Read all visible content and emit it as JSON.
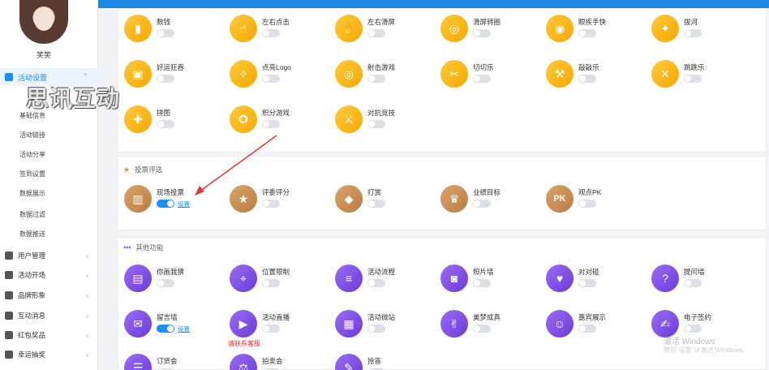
{
  "user": {
    "name": "笑笑"
  },
  "sidebar": {
    "active_menu": "活动设置",
    "submenu": [
      "活动设置",
      "基础信息",
      "活动链接",
      "活动分享",
      "签到设置",
      "数据展示",
      "数据过滤",
      "数据推送"
    ],
    "menus": [
      "用户管理",
      "活动开场",
      "品牌形象",
      "互动消息",
      "红包奖品",
      "幸运抽奖"
    ]
  },
  "watermark": "思讯互动",
  "sections": {
    "vote_title": "投票评选",
    "other_title": "其他功能"
  },
  "games": [
    {
      "label": "数钱",
      "icon": "money-icon"
    },
    {
      "label": "左右点击",
      "icon": "tap-icon"
    },
    {
      "label": "左右滑屏",
      "icon": "swipe-icon"
    },
    {
      "label": "滑屏转圈",
      "icon": "spin-icon"
    },
    {
      "label": "眼疾手快",
      "icon": "eye-icon"
    },
    {
      "label": "拔河",
      "icon": "tug-icon"
    },
    {
      "label": "好运狂吞",
      "icon": "bucket-icon"
    },
    {
      "label": "点亮Logo",
      "icon": "torch-icon"
    },
    {
      "label": "射击游戏",
      "icon": "target-icon"
    },
    {
      "label": "切切乐",
      "icon": "slice-icon"
    },
    {
      "label": "敲敲乐",
      "icon": "hammer-icon"
    },
    {
      "label": "跳跳乐",
      "icon": "jump-icon"
    },
    {
      "label": "拼图",
      "icon": "puzzle-icon"
    },
    {
      "label": "积分游戏",
      "icon": "score-icon"
    },
    {
      "label": "对抗竞技",
      "icon": "battle-icon"
    }
  ],
  "votes": [
    {
      "label": "现场投票",
      "icon": "bar-icon",
      "on": true,
      "link": "设置"
    },
    {
      "label": "评委评分",
      "icon": "judge-icon"
    },
    {
      "label": "打赏",
      "icon": "diamond-icon"
    },
    {
      "label": "业绩目标",
      "icon": "trophy-icon"
    },
    {
      "label": "观点PK",
      "icon": "pk-icon",
      "glyph": "PK"
    }
  ],
  "others": [
    {
      "label": "你画我猜",
      "icon": "clapper-icon"
    },
    {
      "label": "位置限制",
      "icon": "pin-icon"
    },
    {
      "label": "活动流程",
      "icon": "layers-icon"
    },
    {
      "label": "照片墙",
      "icon": "camera-icon"
    },
    {
      "label": "对对碰",
      "icon": "heart-icon"
    },
    {
      "label": "提问墙",
      "icon": "question-icon"
    },
    {
      "label": "留言墙",
      "icon": "message-icon",
      "on": true,
      "link": "设置"
    },
    {
      "label": "活动直播",
      "icon": "video-icon",
      "note": "请联系客服"
    },
    {
      "label": "活动微站",
      "icon": "phone-icon"
    },
    {
      "label": "美梦成真",
      "icon": "hand-icon"
    },
    {
      "label": "嘉宾展示",
      "icon": "guest-icon"
    },
    {
      "label": "电子签约",
      "icon": "sign-icon"
    },
    {
      "label": "订货会",
      "icon": "order-icon"
    },
    {
      "label": "拍卖会",
      "icon": "auction-icon"
    },
    {
      "label": "抢答",
      "icon": "answer-icon"
    }
  ],
  "windows": {
    "line1": "激活 Windows",
    "line2": "转到\"设置\"以激活 Windows。"
  },
  "colors": {
    "accent": "#1890ff",
    "topbar": "#1e88e5",
    "game": "#f6b31b",
    "vote": "#c8935a",
    "other": "#7b4ae2"
  }
}
